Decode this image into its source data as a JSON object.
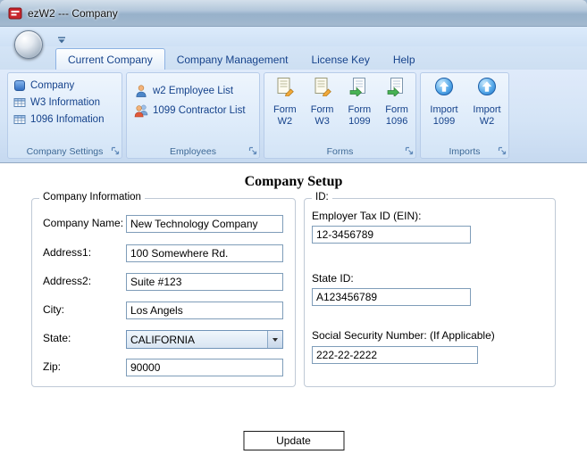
{
  "window": {
    "title": "ezW2 --- Company"
  },
  "colors": {
    "app_icon_red": "#c9252c",
    "ribbon_item_text": "#15428b",
    "group_caption_text": "#3e6996",
    "ribbon_background": "#d4e4f6"
  },
  "icons": {
    "app": "ezw2-app-icon",
    "orb": "application-menu-orb",
    "qat": "qat-customize-dropdown-icon",
    "company": "blue-cube-icon",
    "w3_info": "table-grid-icon",
    "info_1096": "table-grid-icon",
    "employee": "person-icon",
    "contractor": "two-persons-icon",
    "form_w2": "document-pencil-icon",
    "form_w3": "document-pencil-icon",
    "form_1099": "document-green-arrow-icon",
    "form_1096": "document-green-arrow-icon",
    "import": "blue-globe-up-arrow-icon",
    "launcher": "dialog-launcher-icon",
    "combo_arrow": "dropdown-arrow-icon"
  },
  "ribbon": {
    "tabs": [
      {
        "label": "Current Company",
        "active": true
      },
      {
        "label": "Company Management",
        "active": false
      },
      {
        "label": "License Key",
        "active": false
      },
      {
        "label": "Help",
        "active": false
      }
    ],
    "company_settings": {
      "caption": "Company Settings",
      "items": [
        "Company",
        "W3 Information",
        "1096 Infomation"
      ]
    },
    "employees": {
      "caption": "Employees",
      "items": [
        "w2 Employee List",
        "1099 Contractor List"
      ]
    },
    "forms": {
      "caption": "Forms",
      "buttons": [
        {
          "top": "Form",
          "bottom": "W2"
        },
        {
          "top": "Form",
          "bottom": "W3"
        },
        {
          "top": "Form",
          "bottom": "1099"
        },
        {
          "top": "Form",
          "bottom": "1096"
        }
      ]
    },
    "imports": {
      "caption": "Imports",
      "buttons": [
        {
          "top": "Import",
          "bottom": "1099"
        },
        {
          "top": "Import",
          "bottom": "W2"
        }
      ]
    }
  },
  "main": {
    "page_title": "Company Setup",
    "company_info": {
      "legend": "Company Information",
      "company_name": {
        "label": "Company Name:",
        "value": "New Technology Company"
      },
      "address1": {
        "label": "Address1:",
        "value": "100 Somewhere Rd."
      },
      "address2": {
        "label": "Address2:",
        "value": "Suite #123"
      },
      "city": {
        "label": "City:",
        "value": "Los Angels"
      },
      "state": {
        "label": "State:",
        "value": "CALIFORNIA"
      },
      "zip": {
        "label": "Zip:",
        "value": "90000"
      }
    },
    "ids": {
      "legend": "ID:",
      "ein": {
        "label": "Employer Tax ID (EIN):",
        "value": "12-3456789"
      },
      "state_id": {
        "label": "State ID:",
        "value": "A123456789"
      },
      "ssn": {
        "label": "Social Security Number: (If Applicable)",
        "value": "222-22-2222"
      }
    },
    "update_button": "Update"
  }
}
